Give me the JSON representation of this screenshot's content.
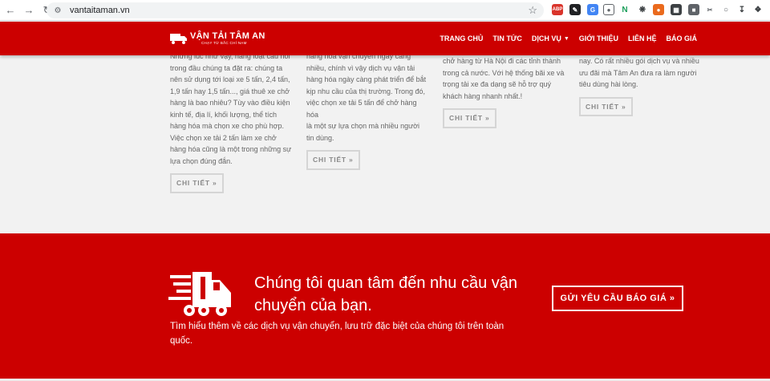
{
  "browser": {
    "url": "vantaitaman.vn",
    "extensions": [
      "ABP",
      "N"
    ]
  },
  "header": {
    "logo_brand": "VẬN TẢI TÂM AN",
    "logo_tagline": "CHẠY TỪ BẮC CHÍ NAM",
    "menu": [
      {
        "label": "TRANG CHỦ"
      },
      {
        "label": "TIN TỨC"
      },
      {
        "label": "DỊCH VỤ"
      },
      {
        "label": "GIỚI THIỆU"
      },
      {
        "label": "LIÊN HỆ"
      },
      {
        "label": "BÁO GIÁ"
      }
    ]
  },
  "posts": [
    {
      "lines": [
        "Những lúc như vậy, hàng loạt câu hỏi",
        "trong đầu chúng ta đặt ra: chúng ta",
        "nên sử dụng tới loại xe 5 tấn, 2,4 tấn,",
        "1,9 tấn hay 1,5 tấn..., giá thuê xe chở",
        "hàng là bao nhiêu? Tùy vào điều kiện",
        "kinh tế, địa lí, khối lượng, thể tích",
        "hàng hóa mà chọn xe cho phù hợp.",
        "Việc chọn xe tải 2 tấn làm xe chở",
        "hàng hóa cũng là một trong những sự",
        "lựa chọn đúng đắn."
      ],
      "button": "CHI TIẾT »"
    },
    {
      "lines": [
        "hàng hóa vận chuyển ngày càng",
        "nhiều, chính vì vậy dịch vụ vận tải",
        "hàng hóa ngày càng phát triển để bắt",
        "kịp nhu cầu của thị trường. Trong đó,",
        "việc chọn xe tải 5 tấn để chở hàng hóa",
        "là một sự lựa chọn mà nhiều người",
        "tin dùng."
      ],
      "button": "CHI TIẾT »"
    },
    {
      "lines": [
        "chở hàng từ Hà Nội đi các tỉnh thành",
        "trong cả nước. Với hệ thống bãi xe và",
        "trọng tải xe đa dạng sẽ hỗ trợ quý",
        "khách hàng nhanh nhất.!"
      ],
      "button": "CHI TIẾT »"
    },
    {
      "lines": [
        "nay. Có rất nhiều gói dịch vụ và nhiều",
        "ưu đãi mà Tâm An đưa ra làm người",
        "tiêu dùng hài lòng."
      ],
      "button": "CHI TIẾT »"
    }
  ],
  "cta": {
    "title": "Chúng tôi quan tâm đến nhu cầu vận chuyển của bạn.",
    "subtitle": "Tìm hiểu thêm về các dịch vụ vận chuyển, lưu trữ đặc biệt của chúng tôi trên toàn quốc.",
    "button": "GỬI YÊU CẦU BÁO GIÁ »"
  },
  "colors": {
    "brand_red": "#cc0000",
    "body_text": "#666666",
    "button_border": "#d5d5d5"
  }
}
